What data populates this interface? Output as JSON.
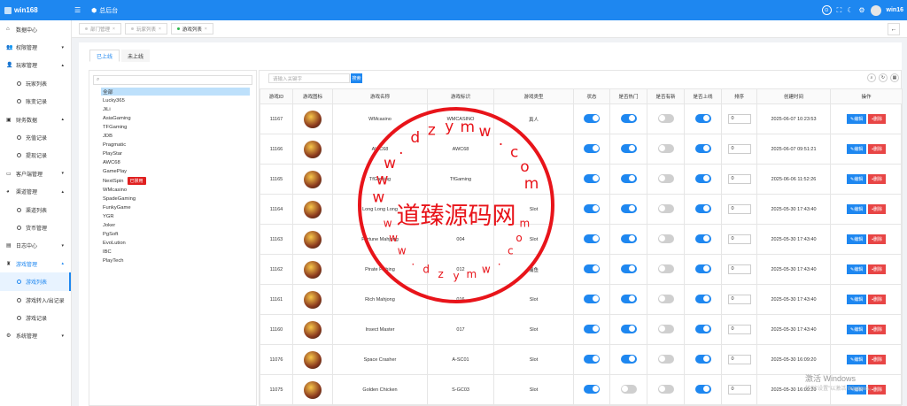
{
  "topbar": {
    "app_name": "win168",
    "back_label": "总后台",
    "username": "win16"
  },
  "sidebar": {
    "items": [
      {
        "label": "数据中心",
        "icon": "home-icon",
        "type": "menu",
        "arrow": ""
      },
      {
        "label": "权限管理",
        "icon": "users-icon",
        "type": "menu",
        "arrow": "▾"
      },
      {
        "label": "玩家管理",
        "icon": "user-icon",
        "type": "menu",
        "arrow": "▴"
      },
      {
        "label": "玩家列表",
        "type": "sub"
      },
      {
        "label": "账变记录",
        "type": "sub"
      },
      {
        "label": "财务数据",
        "icon": "finance-icon",
        "type": "menu",
        "arrow": "▴"
      },
      {
        "label": "充值记录",
        "type": "sub"
      },
      {
        "label": "提现记录",
        "type": "sub"
      },
      {
        "label": "客户端管理",
        "icon": "client-icon",
        "type": "menu",
        "arrow": "▾"
      },
      {
        "label": "渠道管理",
        "icon": "channel-icon",
        "type": "menu",
        "arrow": "▴"
      },
      {
        "label": "渠道列表",
        "type": "sub"
      },
      {
        "label": "货币管理",
        "type": "sub"
      },
      {
        "label": "日志中心",
        "icon": "log-icon",
        "type": "menu",
        "arrow": "▾"
      },
      {
        "label": "游戏管理",
        "icon": "game-icon",
        "type": "menu",
        "arrow": "▴",
        "open": true
      },
      {
        "label": "游戏列表",
        "type": "sub",
        "active": true
      },
      {
        "label": "游戏转入/出记录",
        "type": "sub"
      },
      {
        "label": "游戏记录",
        "type": "sub"
      },
      {
        "label": "系统管理",
        "icon": "gear-icon",
        "type": "menu",
        "arrow": "▾"
      }
    ]
  },
  "tabs": [
    {
      "label": "部门管理"
    },
    {
      "label": "玩家列表"
    },
    {
      "label": "游戏列表",
      "active": true
    }
  ],
  "subtabs": {
    "online": "已上线",
    "offline": "未上线"
  },
  "platforms": [
    "全部",
    "Lucky365",
    "JiLi",
    "AsiaGaming",
    "TFGaming",
    "JDB",
    "Pragmatic",
    "PlayStar",
    "AWC68",
    "GamePlay",
    "NextSpin",
    "WMcasino",
    "SpadeGaming",
    "FunkyGame",
    "YGR",
    "Joker",
    "PgSoft",
    "EvoLution",
    "IBC",
    "PlayTech"
  ],
  "platform_badge": "已禁用",
  "search": {
    "placeholder": "请输入关键字",
    "button": "搜索"
  },
  "table": {
    "headers": [
      "游戏ID",
      "游戏图标",
      "游戏名称",
      "游戏标识",
      "游戏类型",
      "状态",
      "是否热门",
      "是否有新",
      "是否上线",
      "排序",
      "创建时间",
      "操作"
    ],
    "edit_label": "编辑",
    "delete_label": "删除",
    "rows": [
      {
        "id": "11167",
        "name": "WMcasino",
        "code": "WMCASINO",
        "type": "真人",
        "status": true,
        "hot": true,
        "new": false,
        "online": true,
        "sort": "0",
        "created": "2025-06-07 10:23:53"
      },
      {
        "id": "11166",
        "name": "AWC68",
        "code": "AWC68",
        "type": "",
        "status": true,
        "hot": true,
        "new": false,
        "online": true,
        "sort": "0",
        "created": "2025-06-07 09:51:21"
      },
      {
        "id": "11165",
        "name": "TfGaming",
        "code": "TfGaming",
        "type": "",
        "status": true,
        "hot": true,
        "new": false,
        "online": true,
        "sort": "0",
        "created": "2025-06-06 11:52:26"
      },
      {
        "id": "11164",
        "name": "Long Long Long",
        "code": "",
        "type": "Slot",
        "status": true,
        "hot": true,
        "new": false,
        "online": true,
        "sort": "0",
        "created": "2025-05-30 17:43:40"
      },
      {
        "id": "11163",
        "name": "Fortune Mahjong",
        "code": "004",
        "type": "Slot",
        "status": true,
        "hot": true,
        "new": false,
        "online": true,
        "sort": "0",
        "created": "2025-05-30 17:43:40"
      },
      {
        "id": "11162",
        "name": "Pirate Fishing",
        "code": "012",
        "type": "捕鱼",
        "status": true,
        "hot": true,
        "new": false,
        "online": true,
        "sort": "0",
        "created": "2025-05-30 17:43:40"
      },
      {
        "id": "11161",
        "name": "Rich Mahjong",
        "code": "016",
        "type": "Slot",
        "status": true,
        "hot": true,
        "new": false,
        "online": true,
        "sort": "0",
        "created": "2025-05-30 17:43:40"
      },
      {
        "id": "11160",
        "name": "Insect Master",
        "code": "017",
        "type": "Slot",
        "status": true,
        "hot": true,
        "new": false,
        "online": true,
        "sort": "0",
        "created": "2025-05-30 17:43:40"
      },
      {
        "id": "11076",
        "name": "Space Crasher",
        "code": "A-SC01",
        "type": "Slot",
        "status": true,
        "hot": true,
        "new": false,
        "online": true,
        "sort": "0",
        "created": "2025-05-30 16:09:20"
      },
      {
        "id": "11075",
        "name": "Golden Chicken",
        "code": "S-GC03",
        "type": "Slot",
        "status": true,
        "hot": false,
        "new": false,
        "online": true,
        "sort": "0",
        "created": "2025-05-30 16:09:20"
      }
    ]
  },
  "watermark": {
    "text": "道臻源码网",
    "url_chars": "www.dzymw.com",
    "color": "#e8141a"
  },
  "windows": {
    "title": "激活 Windows",
    "sub": "转到\"设置\"以激活 Windows。"
  }
}
